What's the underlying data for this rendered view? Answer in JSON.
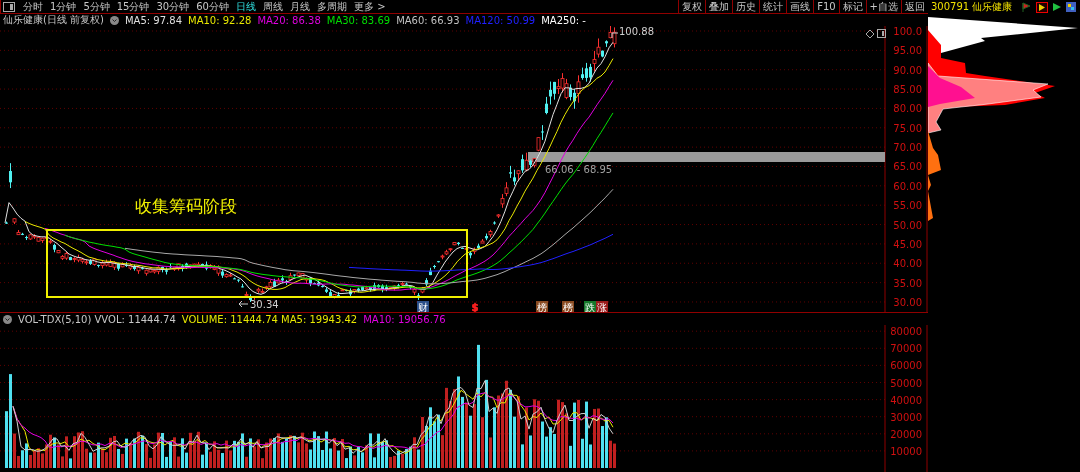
{
  "toolbar": {
    "periods": [
      {
        "label": "分时",
        "selected": false
      },
      {
        "label": "1分钟",
        "selected": false
      },
      {
        "label": "5分钟",
        "selected": false
      },
      {
        "label": "15分钟",
        "selected": false
      },
      {
        "label": "30分钟",
        "selected": false
      },
      {
        "label": "60分钟",
        "selected": false
      },
      {
        "label": "日线",
        "selected": true
      },
      {
        "label": "周线",
        "selected": false
      },
      {
        "label": "月线",
        "selected": false
      },
      {
        "label": "多周期",
        "selected": false
      },
      {
        "label": "更多 >",
        "selected": false
      }
    ],
    "tools": [
      "复权",
      "叠加",
      "历史",
      "统计",
      "画线",
      "F10",
      "标记",
      "+自选",
      "返回"
    ]
  },
  "stock_header": {
    "code": "300791",
    "name": "仙乐健康"
  },
  "price_panel": {
    "title": "仙乐健康(日线 前复权)",
    "indicators": [
      {
        "label": "MA5: 97.84",
        "color": "#e0e0e0"
      },
      {
        "label": "MA10: 92.28",
        "color": "#e8e800"
      },
      {
        "label": "MA20: 86.38",
        "color": "#e000e0"
      },
      {
        "label": "MA30: 83.69",
        "color": "#00e000"
      },
      {
        "label": "MA60: 66.93",
        "color": "#c0c0c0"
      },
      {
        "label": "MA120: 50.99",
        "color": "#2020ff"
      },
      {
        "label": "MA250: -",
        "color": "#ffffff"
      }
    ],
    "axis_labels": [
      "100.0",
      "95.00",
      "90.00",
      "85.00",
      "80.00",
      "75.00",
      "70.00",
      "65.00",
      "60.00",
      "55.00",
      "50.00",
      "45.00",
      "40.00",
      "35.00",
      "30.00"
    ],
    "annotation": "收集筹码阶段",
    "high_label": "100.88",
    "low_label": "30.34",
    "range_label": "66.06 - 68.95",
    "event_markers": [
      {
        "label": "财",
        "kind": "badge",
        "color": "#2a4f8a"
      },
      {
        "label": "$",
        "kind": "symbol",
        "color": "#ff2020"
      },
      {
        "label": "榜",
        "kind": "badge",
        "color": "#8a4a20"
      },
      {
        "label": "榜",
        "kind": "badge",
        "color": "#8a4a20"
      },
      {
        "label": "跌",
        "kind": "badge",
        "color": "#16782a"
      },
      {
        "label": "涨",
        "kind": "badge",
        "color": "#9a1a1a"
      }
    ]
  },
  "volume_panel": {
    "indicators": [
      {
        "label": "VOL-TDX(5,10) VVOL: 11444.74",
        "color": "#c8c8c8"
      },
      {
        "label": "VOLUME: 11444.74 MA5: 19943.42",
        "color": "#e8e800"
      },
      {
        "label": "MA10: 19056.76",
        "color": "#e000e0"
      }
    ],
    "axis_labels": [
      "80000",
      "70000",
      "60000",
      "50000",
      "40000",
      "30000",
      "20000",
      "10000"
    ]
  }
}
